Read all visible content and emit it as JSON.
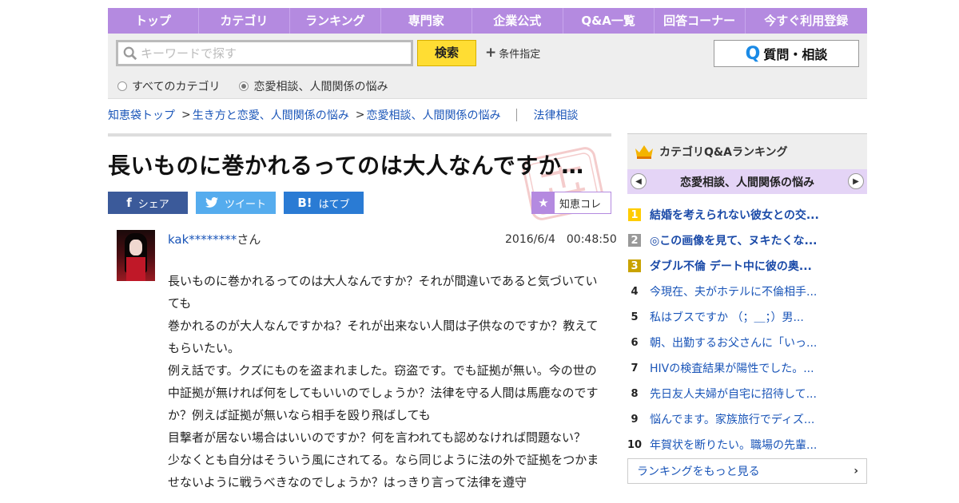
{
  "nav": {
    "items": [
      "トップ",
      "カテゴリ",
      "ランキング",
      "専門家",
      "企業公式",
      "Q&A一覧",
      "回答コーナー",
      "今すぐ利用登録"
    ]
  },
  "search": {
    "placeholder": "キーワードで探す",
    "button_label": "検索",
    "conditions_label": "条件指定",
    "qa_button_label": "質問・相談",
    "qa_button_icon": "Q",
    "radio_all": "すべてのカテゴリ",
    "radio_current": "恋愛相談、人間関係の悩み",
    "selected_radio": "radio_current"
  },
  "breadcrumb": {
    "items": [
      "知恵袋トップ",
      "生き方と恋愛、人間関係の悩み",
      "恋愛相談、人間関係の悩み"
    ],
    "separator": ">",
    "related": "法律相談"
  },
  "question": {
    "title": "長いものに巻かれるってのは大人なんですか…",
    "share": {
      "facebook": "シェア",
      "twitter": "ツイート",
      "hatena": "はてブ",
      "chiekore": "知恵コレ"
    },
    "user_id": "kak********",
    "user_suffix": "さん",
    "date": "2016/6/4　00:48:50",
    "body": [
      "長いものに巻かれるってのは大人なんですか？それが間違いであると気づいていても",
      "巻かれるのが大人なんですかね？それが出来ない人間は子供なのですか？教えてもらいたい。",
      "例え話です。クズにものを盗まれました。窃盗です。でも証拠が無い。今の世の中証拠が無ければ何をしてもいいのでしょうか？法律を守る人間は馬鹿なのですか？例えば証拠が無いなら相手を殴り飛ばしても",
      "目撃者が居ない場合はいいのですか？何を言われても認めなければ問題ない？",
      "少なくとも自分はそういう風にされてる。なら同じように法の外で証拠をつかませないように戦うべきなのでしょうか？はっきり言って法律を遵守"
    ]
  },
  "ranking": {
    "header": "カテゴリQ&Aランキング",
    "category": "恋愛相談、人間関係の悩み",
    "items": [
      {
        "num": "1",
        "title": "結婚を考えられない彼女との交..."
      },
      {
        "num": "2",
        "title": "◎この画像を見て、ヌキたくな..."
      },
      {
        "num": "3",
        "title": "ダブル不倫 デート中に彼の奥..."
      },
      {
        "num": "4",
        "title": "今現在、夫がホテルに不倫相手..."
      },
      {
        "num": "5",
        "title": "私はブスですか （；＿；）男..."
      },
      {
        "num": "6",
        "title": "朝、出勤するお父さんに「いっ..."
      },
      {
        "num": "7",
        "title": "HIVの検査結果が陽性でした。..."
      },
      {
        "num": "8",
        "title": "先日友人夫婦が自宅に招待して..."
      },
      {
        "num": "9",
        "title": "悩んでます。家族旅行でディズ..."
      },
      {
        "num": "10",
        "title": "年賀状を断りたい。職場の先輩..."
      }
    ],
    "more_label": "ランキングをもっと見る"
  },
  "colors": {
    "nav_bg": "#b48ae0",
    "link": "#1a55b8",
    "search_button": "#ffdd33",
    "facebook": "#3b5a9a",
    "twitter": "#55acee",
    "hatena": "#2a7bd4"
  }
}
